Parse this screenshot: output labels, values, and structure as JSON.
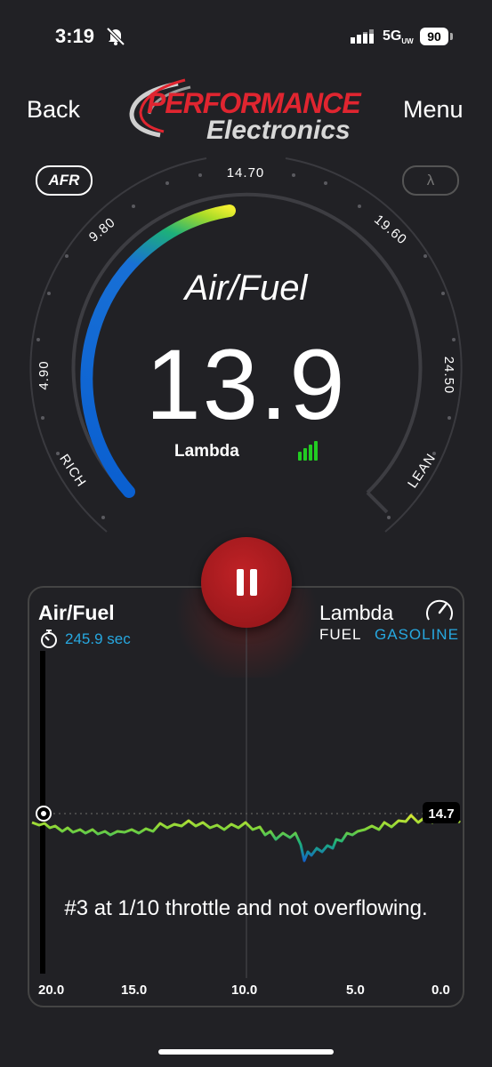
{
  "status": {
    "time": "3:19",
    "network": "5G",
    "network_sub": "UW",
    "battery": "90"
  },
  "header": {
    "back_label": "Back",
    "menu_label": "Menu",
    "logo_line1": "PERFORMANCE",
    "logo_line2": "Electronics"
  },
  "modes": {
    "afr_label": "AFR",
    "lambda_label": "λ"
  },
  "gauge": {
    "title": "Air/Fuel",
    "value": "13.9",
    "unit_label": "Lambda",
    "ticks": [
      "4.90",
      "9.80",
      "14.70",
      "19.60",
      "24.50"
    ],
    "rich_label": "RICH",
    "lean_label": "LEAN",
    "min": 4.9,
    "max": 24.5,
    "current": 13.9
  },
  "panel": {
    "title": "Air/Fuel",
    "elapsed": "245.9 sec",
    "lambda_label": "Lambda",
    "fuel_label": "FUEL",
    "fuel_value": "GASOLINE",
    "x_ticks": [
      "20.0",
      "15.0",
      "10.0",
      "5.0",
      "0.0"
    ],
    "reference_value": "14.7",
    "comment": "#3 at 1/10 throttle and not overflowing."
  },
  "colors": {
    "accent_blue": "#27a8e0",
    "pause_red": "#b01c20",
    "signal_green": "#22cc22"
  }
}
